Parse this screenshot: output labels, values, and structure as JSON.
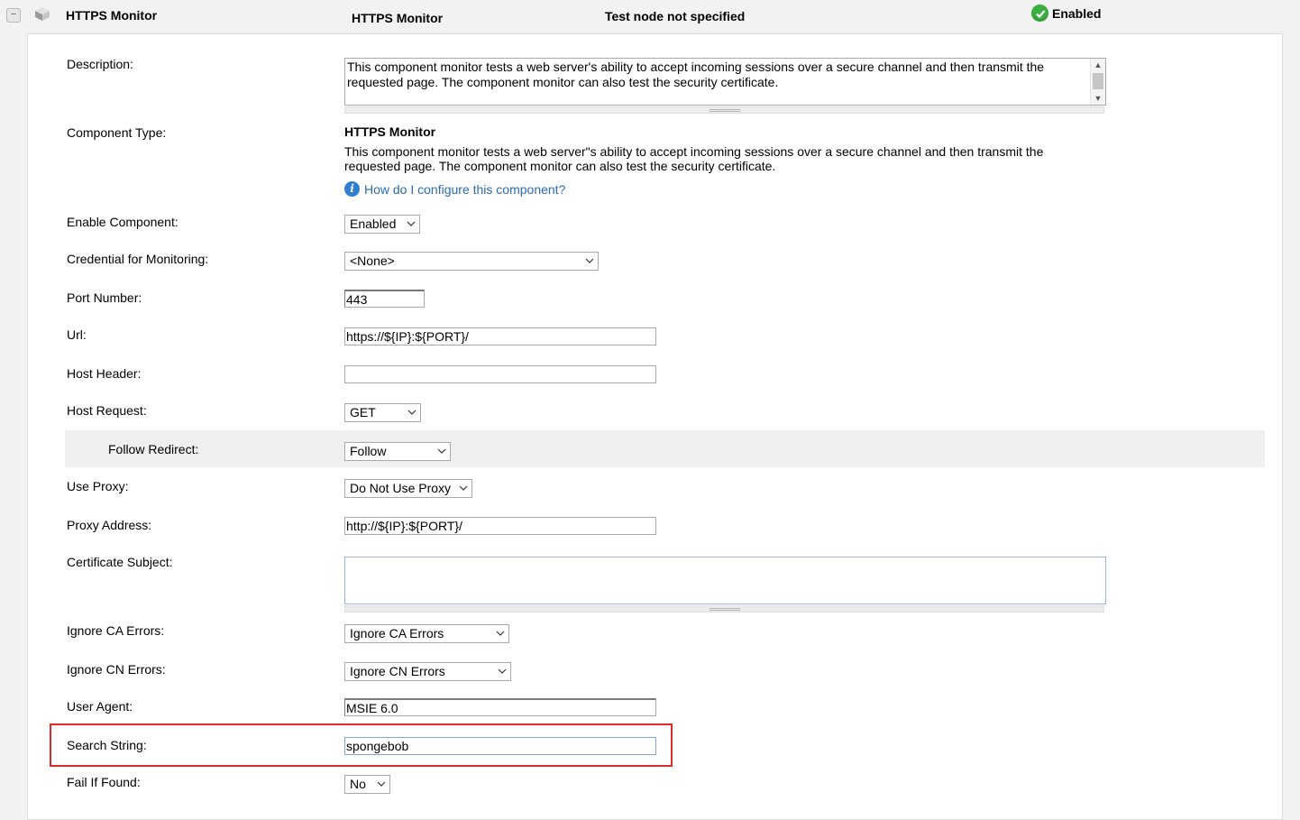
{
  "header": {
    "collapse_symbol": "−",
    "name": "HTTPS Monitor",
    "type": "HTTPS Monitor",
    "test_node": "Test node not specified",
    "status": "Enabled",
    "status_color": "#3cb043"
  },
  "form": {
    "description": {
      "label": "Description:",
      "value": "This component monitor tests a web server's ability to accept incoming sessions over a secure channel and then transmit the requested page. The component monitor can also test the security certificate."
    },
    "component_type": {
      "label": "Component Type:",
      "title": "HTTPS Monitor",
      "description": "This component monitor tests a web server\"s ability to accept incoming sessions over a secure channel and then transmit the requested page. The component monitor can also test the security certificate.",
      "help_link": "How do I configure this component?",
      "help_icon": "info-icon"
    },
    "enable_component": {
      "label": "Enable Component:",
      "value": "Enabled"
    },
    "credential": {
      "label": "Credential for Monitoring:",
      "value": "<None>"
    },
    "port": {
      "label": "Port Number:",
      "value": "443"
    },
    "url": {
      "label": "Url:",
      "value": "https://${IP}:${PORT}/"
    },
    "host_header": {
      "label": "Host Header:",
      "value": ""
    },
    "host_request": {
      "label": "Host Request:",
      "value": "GET"
    },
    "follow_redirect": {
      "label": "Follow Redirect:",
      "value": "Follow"
    },
    "use_proxy": {
      "label": "Use Proxy:",
      "value": "Do Not Use Proxy"
    },
    "proxy_address": {
      "label": "Proxy Address:",
      "value": "http://${IP}:${PORT}/"
    },
    "certificate_subject": {
      "label": "Certificate Subject:",
      "value": ""
    },
    "ignore_ca": {
      "label": "Ignore CA Errors:",
      "value": "Ignore CA Errors"
    },
    "ignore_cn": {
      "label": "Ignore CN Errors:",
      "value": "Ignore CN Errors"
    },
    "user_agent": {
      "label": "User Agent:",
      "value": "MSIE 6.0"
    },
    "search_string": {
      "label": "Search String:",
      "value": "spongebob"
    },
    "fail_if_found": {
      "label": "Fail If Found:",
      "value": "No"
    }
  },
  "colors": {
    "link": "#2a6ab5",
    "highlight_border": "#e02a2a"
  }
}
